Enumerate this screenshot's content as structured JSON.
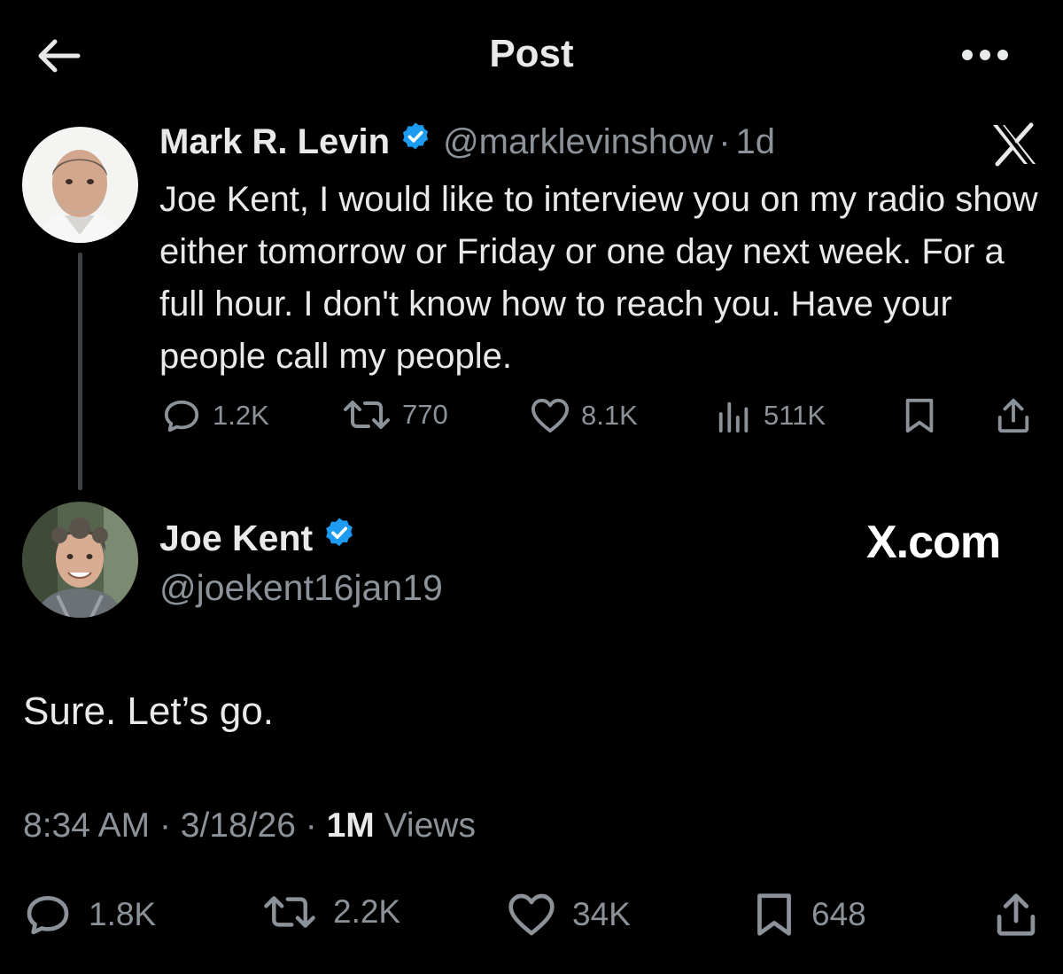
{
  "header": {
    "title": "Post",
    "back_icon": "arrow-left-icon",
    "more_icon": "more-horizontal-icon"
  },
  "parent_tweet": {
    "author_name": "Mark R. Levin",
    "handle": "@marklevinshow",
    "separator": "·",
    "time_ago": "1d",
    "text": "Joe Kent, I would like to interview you on my radio show either tomorrow or Friday or one day next week.  For a full hour.  I don't know how to reach you.  Have your people call my people.",
    "stats": {
      "replies": "1.2K",
      "reposts": "770",
      "likes": "8.1K",
      "views": "511K"
    }
  },
  "reply_tweet": {
    "author_name": "Joe Kent",
    "handle": "@joekent16jan19",
    "text": "Sure. Let’s go.",
    "time": "8:34 AM",
    "date": "3/18/26",
    "separator": "·",
    "views_count": "1M",
    "views_label": "Views",
    "stats": {
      "replies": "1.8K",
      "reposts": "2.2K",
      "likes": "34K",
      "bookmarks": "648"
    }
  },
  "watermark": {
    "brand": "X.com"
  },
  "colors": {
    "background": "#000000",
    "text_primary": "#e7e9ea",
    "text_secondary": "#8b9299",
    "verified_blue": "#1d9bf0",
    "thread_line": "#3e4144"
  }
}
